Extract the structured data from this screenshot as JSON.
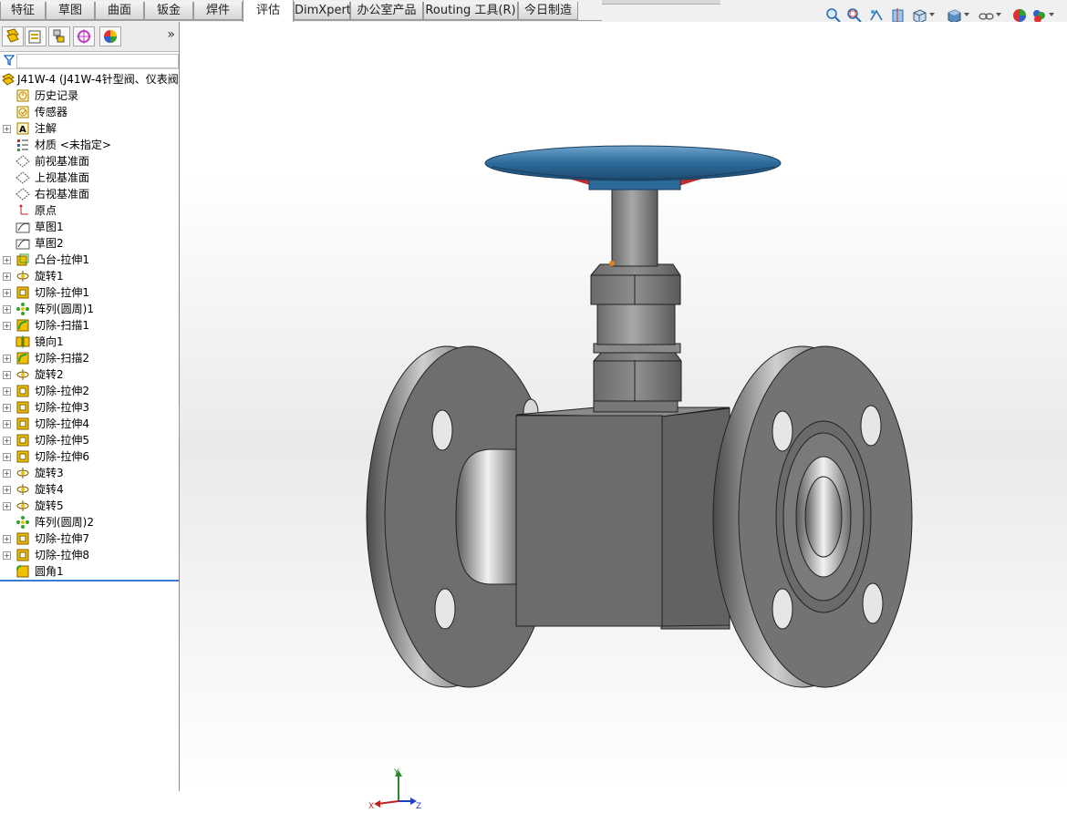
{
  "tabs": [
    {
      "label": "特征",
      "active": false
    },
    {
      "label": "草图",
      "active": false
    },
    {
      "label": "曲面",
      "active": false
    },
    {
      "label": "钣金",
      "active": false
    },
    {
      "label": "焊件",
      "active": false
    },
    {
      "label": "评估",
      "active": true
    },
    {
      "label": "DimXpert",
      "active": false
    },
    {
      "label": "办公室产品",
      "active": false
    },
    {
      "label": "Routing 工具(R)",
      "active": false
    },
    {
      "label": "今日制造",
      "active": false
    }
  ],
  "panel": {
    "tabs": [
      "feature-manager-icon",
      "property-manager-icon",
      "configuration-manager-icon",
      "dimxpert-manager-icon",
      "display-manager-icon"
    ],
    "expand_symbol": "»",
    "filter_icon": "filter-icon"
  },
  "tree": {
    "root": {
      "label": "J41W-4  (J41W-4针型阀、仪表阀",
      "icon": "part-icon"
    },
    "items": [
      {
        "label": "历史记录",
        "icon": "history-icon",
        "expand": false
      },
      {
        "label": "传感器",
        "icon": "sensor-icon",
        "expand": false
      },
      {
        "label": "注解",
        "icon": "annotation-icon",
        "expand": true
      },
      {
        "label": "材质 <未指定>",
        "icon": "material-icon",
        "expand": false
      },
      {
        "label": "前视基准面",
        "icon": "plane-icon",
        "expand": false
      },
      {
        "label": "上视基准面",
        "icon": "plane-icon",
        "expand": false
      },
      {
        "label": "右视基准面",
        "icon": "plane-icon",
        "expand": false
      },
      {
        "label": "原点",
        "icon": "origin-icon",
        "expand": false
      },
      {
        "label": "草图1",
        "icon": "sketch-icon",
        "expand": false
      },
      {
        "label": "草图2",
        "icon": "sketch-icon",
        "expand": false
      },
      {
        "label": "凸台-拉伸1",
        "icon": "boss-extrude-icon",
        "expand": true
      },
      {
        "label": "旋转1",
        "icon": "revolve-icon",
        "expand": true
      },
      {
        "label": "切除-拉伸1",
        "icon": "cut-extrude-icon",
        "expand": true
      },
      {
        "label": "阵列(圆周)1",
        "icon": "circular-pattern-icon",
        "expand": true
      },
      {
        "label": "切除-扫描1",
        "icon": "cut-sweep-icon",
        "expand": true
      },
      {
        "label": "镜向1",
        "icon": "mirror-icon",
        "expand": false
      },
      {
        "label": "切除-扫描2",
        "icon": "cut-sweep-icon",
        "expand": true
      },
      {
        "label": "旋转2",
        "icon": "revolve-icon",
        "expand": true
      },
      {
        "label": "切除-拉伸2",
        "icon": "cut-extrude-icon",
        "expand": true
      },
      {
        "label": "切除-拉伸3",
        "icon": "cut-extrude-icon",
        "expand": true
      },
      {
        "label": "切除-拉伸4",
        "icon": "cut-extrude-icon",
        "expand": true
      },
      {
        "label": "切除-拉伸5",
        "icon": "cut-extrude-icon",
        "expand": true
      },
      {
        "label": "切除-拉伸6",
        "icon": "cut-extrude-icon",
        "expand": true
      },
      {
        "label": "旋转3",
        "icon": "revolve-icon",
        "expand": true
      },
      {
        "label": "旋转4",
        "icon": "revolve-icon",
        "expand": true
      },
      {
        "label": "旋转5",
        "icon": "revolve-icon",
        "expand": true
      },
      {
        "label": "阵列(圆周)2",
        "icon": "circular-pattern-icon",
        "expand": false
      },
      {
        "label": "切除-拉伸7",
        "icon": "cut-extrude-icon",
        "expand": true
      },
      {
        "label": "切除-拉伸8",
        "icon": "cut-extrude-icon",
        "expand": true
      },
      {
        "label": "圆角1",
        "icon": "fillet-icon",
        "expand": false
      }
    ]
  },
  "view_toolbar": [
    "zoom-to-fit-icon",
    "zoom-to-area-icon",
    "previous-view-icon",
    "section-view-icon",
    "view-orientation-icon",
    "display-style-icon",
    "hide-show-items-icon",
    "edit-appearance-icon",
    "apply-scene-icon"
  ],
  "triad": {
    "x": "X",
    "y": "Y",
    "z": "Z"
  },
  "colors": {
    "handwheel": "#2d6a9a",
    "body": "#6c6c6c",
    "accent_red": "#c03030",
    "rollback": "#3a7bd5"
  }
}
